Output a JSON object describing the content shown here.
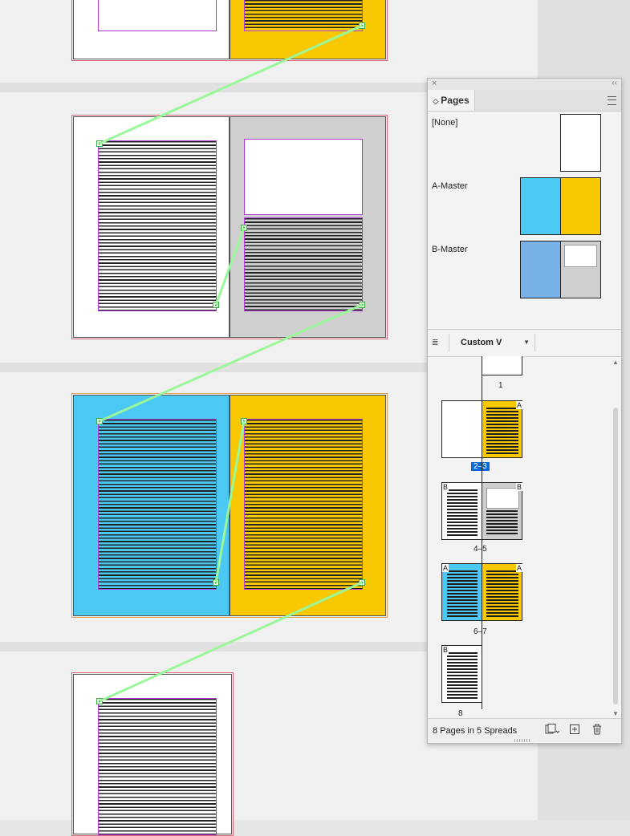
{
  "panel": {
    "close_glyph": "×",
    "collapse_glyph": "‹‹",
    "tab_label": "Pages",
    "masters": [
      {
        "label": "[None]"
      },
      {
        "label": "A-Master",
        "colors": [
          "#4cc8f4",
          "#f9c800"
        ]
      },
      {
        "label": "B-Master",
        "colors": [
          "#78b0e8",
          "#cfcfcf"
        ]
      }
    ],
    "view_select": "Custom V",
    "page_labels": {
      "p1": "1",
      "s23": "2–3",
      "s45": "4–5",
      "s67": "6–7",
      "p8": "8"
    },
    "master_letters": {
      "a": "A",
      "b": "B"
    },
    "footer_text": "8 Pages in 5 Spreads",
    "icons": [
      "menu-icon",
      "page-size-icon",
      "new-page-icon",
      "delete-page-icon",
      "grip-icon",
      "dropdown-chevron-icon"
    ]
  },
  "colors": {
    "a_left": "#4cc8f4",
    "a_right": "#f9c800",
    "b_right": "#cfcfcf",
    "thread": "#9af79a",
    "selection": "#0a69d6"
  }
}
